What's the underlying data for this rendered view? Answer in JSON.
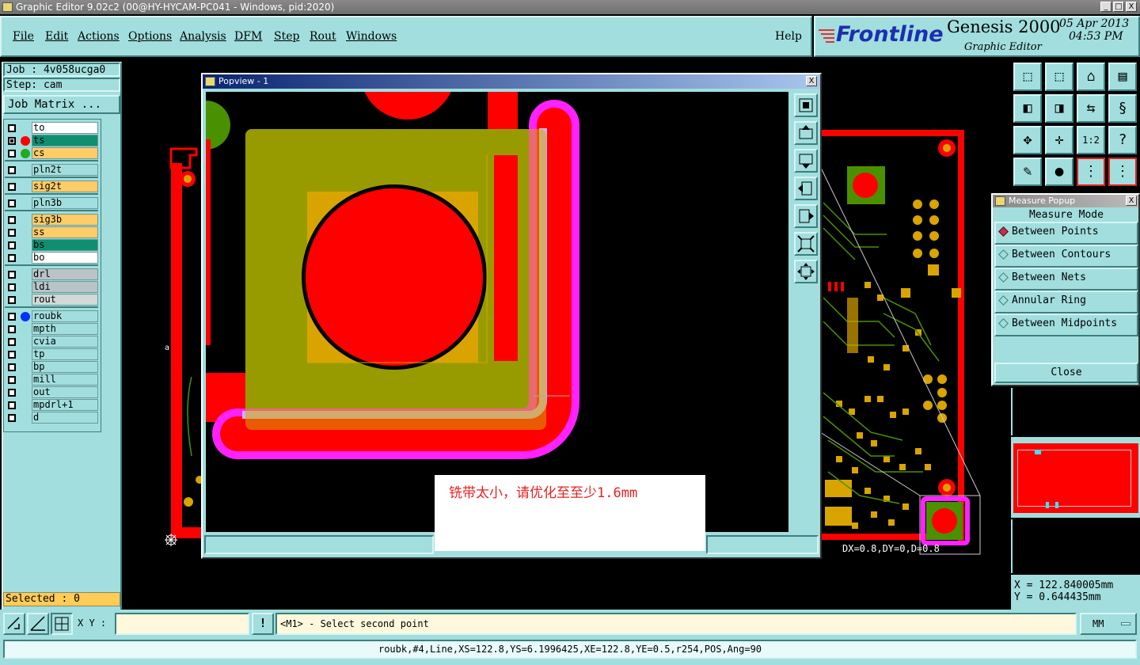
{
  "window": {
    "title": "Graphic Editor 9.02c2 (00@HY-HYCAM-PC041 - Windows, pid:2020)",
    "buttons": [
      "_",
      "□",
      "X"
    ]
  },
  "menu": {
    "items": [
      "File",
      "Edit",
      "Actions",
      "Options",
      "Analysis",
      "DFM",
      "Step",
      "Rout",
      "Windows"
    ],
    "help": "Help"
  },
  "brand": {
    "logo": "Frontline",
    "product": "Genesis 2000",
    "subtitle": "Graphic Editor",
    "date": "05 Apr 2013",
    "time": "04:53 PM"
  },
  "job": {
    "job_label": "Job : 4v058ucga0",
    "step_label": "Step: cam",
    "matrix_button": "Job Matrix ..."
  },
  "layers": [
    {
      "name": "to",
      "color": "#ffffff",
      "dot": ""
    },
    {
      "name": "ts",
      "color": "#0f8f6f",
      "dot": "#ff0000"
    },
    {
      "name": "cs",
      "color": "#ffcc66",
      "dot": "#22aa22"
    },
    {
      "name": "pln2t",
      "color": "#a2dede",
      "dot": ""
    },
    {
      "name": "sig2t",
      "color": "#ffcc66",
      "dot": ""
    },
    {
      "name": "pln3b",
      "color": "#a2dede",
      "dot": ""
    },
    {
      "name": "sig3b",
      "color": "#ffcc66",
      "dot": ""
    },
    {
      "name": "ss",
      "color": "#ffcc66",
      "dot": ""
    },
    {
      "name": "bs",
      "color": "#0f8f6f",
      "dot": ""
    },
    {
      "name": "bo",
      "color": "#ffffff",
      "dot": ""
    },
    {
      "name": "drl",
      "color": "#b8c4c8",
      "dot": ""
    },
    {
      "name": "ldi",
      "color": "#b8c4c8",
      "dot": ""
    },
    {
      "name": "rout",
      "color": "#d0d8d8",
      "dot": ""
    },
    {
      "name": "roubk",
      "color": "#a2dede",
      "dot": "#0033ff"
    },
    {
      "name": "mpth",
      "color": "#a2dede",
      "dot": ""
    },
    {
      "name": "cvia",
      "color": "#a2dede",
      "dot": ""
    },
    {
      "name": "tp",
      "color": "#a2dede",
      "dot": ""
    },
    {
      "name": "bp",
      "color": "#a2dede",
      "dot": ""
    },
    {
      "name": "mill",
      "color": "#a2dede",
      "dot": ""
    },
    {
      "name": "out",
      "color": "#a2dede",
      "dot": ""
    },
    {
      "name": "mpdrl+1",
      "color": "#a2dede",
      "dot": ""
    },
    {
      "name": "d",
      "color": "#a2dede",
      "dot": ""
    }
  ],
  "selected": "Selected : 0",
  "popview": {
    "title": "Popview - 1",
    "close": "X",
    "annotation": "铣带太小，请优化至至少1.6mm"
  },
  "measure": {
    "title": "Measure Popup",
    "mode_header": "Measure Mode",
    "options": [
      "Between Points",
      "Between Contours",
      "Between Nets",
      "Annular Ring",
      "Between Midpoints"
    ],
    "selected_option": "Between Points",
    "close": "Close",
    "readout": "DX=0.8,DY=0,D=0.8"
  },
  "coords": {
    "x": "X = 122.840005mm",
    "y": "Y = 0.644435mm"
  },
  "bottom": {
    "xy_label": "X Y :",
    "xy_value": "",
    "prompt": "<M1> - Select second point",
    "units": "MM",
    "status": "roubk,#4,Line,XS=122.8,YS=6.1996425,XE=122.8,YE=0.5,r254,POS,Ang=90"
  },
  "colors": {
    "panel": "#a2dede",
    "board_red": "#ff0000",
    "copper_green": "#4a9100",
    "pad_orange": "#d9a400",
    "rout_magenta": "#ff22ff"
  }
}
